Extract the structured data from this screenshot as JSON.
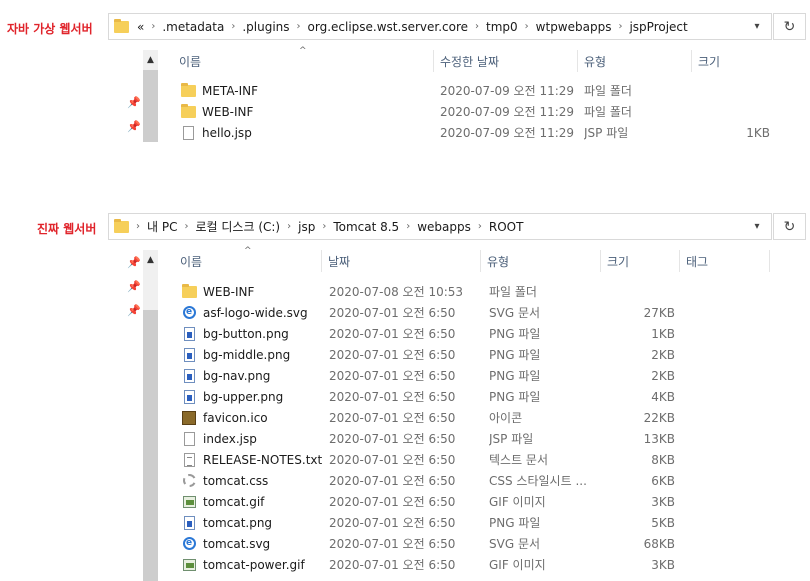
{
  "top": {
    "label": "자바 가상 웹서버",
    "crumbs": [
      "«",
      ".metadata",
      ".plugins",
      "org.eclipse.wst.server.core",
      "tmp0",
      "wtpwebapps",
      "jspProject"
    ],
    "columns": {
      "name": "이름",
      "date": "수정한 날짜",
      "type": "유형",
      "size": "크기"
    },
    "rows": [
      {
        "icon": "folder",
        "name": "META-INF",
        "date": "2020-07-09 오전 11:29",
        "type": "파일 폴더",
        "size": ""
      },
      {
        "icon": "folder",
        "name": "WEB-INF",
        "date": "2020-07-09 오전 11:29",
        "type": "파일 폴더",
        "size": ""
      },
      {
        "icon": "doc",
        "name": "hello.jsp",
        "date": "2020-07-09 오전 11:29",
        "type": "JSP 파일",
        "size": "1KB"
      }
    ]
  },
  "bottom": {
    "label": "진짜 웹서버",
    "crumbs": [
      "내 PC",
      "로컬 디스크 (C:)",
      "jsp",
      "Tomcat 8.5",
      "webapps",
      "ROOT"
    ],
    "columns": {
      "name": "이름",
      "date": "날짜",
      "type": "유형",
      "size": "크기",
      "tag": "태그"
    },
    "rows": [
      {
        "icon": "folder",
        "name": "WEB-INF",
        "date": "2020-07-08 오전 10:53",
        "type": "파일 폴더",
        "size": ""
      },
      {
        "icon": "ie",
        "name": "asf-logo-wide.svg",
        "date": "2020-07-01 오전 6:50",
        "type": "SVG 문서",
        "size": "27KB"
      },
      {
        "icon": "img",
        "name": "bg-button.png",
        "date": "2020-07-01 오전 6:50",
        "type": "PNG 파일",
        "size": "1KB"
      },
      {
        "icon": "img",
        "name": "bg-middle.png",
        "date": "2020-07-01 오전 6:50",
        "type": "PNG 파일",
        "size": "2KB"
      },
      {
        "icon": "img",
        "name": "bg-nav.png",
        "date": "2020-07-01 오전 6:50",
        "type": "PNG 파일",
        "size": "2KB"
      },
      {
        "icon": "img",
        "name": "bg-upper.png",
        "date": "2020-07-01 오전 6:50",
        "type": "PNG 파일",
        "size": "4KB"
      },
      {
        "icon": "ico",
        "name": "favicon.ico",
        "date": "2020-07-01 오전 6:50",
        "type": "아이콘",
        "size": "22KB"
      },
      {
        "icon": "doc",
        "name": "index.jsp",
        "date": "2020-07-01 오전 6:50",
        "type": "JSP 파일",
        "size": "13KB"
      },
      {
        "icon": "txt",
        "name": "RELEASE-NOTES.txt",
        "date": "2020-07-01 오전 6:50",
        "type": "텍스트 문서",
        "size": "8KB"
      },
      {
        "icon": "css",
        "name": "tomcat.css",
        "date": "2020-07-01 오전 6:50",
        "type": "CSS 스타일시트 ...",
        "size": "6KB"
      },
      {
        "icon": "gif",
        "name": "tomcat.gif",
        "date": "2020-07-01 오전 6:50",
        "type": "GIF 이미지",
        "size": "3KB"
      },
      {
        "icon": "img",
        "name": "tomcat.png",
        "date": "2020-07-01 오전 6:50",
        "type": "PNG 파일",
        "size": "5KB"
      },
      {
        "icon": "ie",
        "name": "tomcat.svg",
        "date": "2020-07-01 오전 6:50",
        "type": "SVG 문서",
        "size": "68KB"
      },
      {
        "icon": "gif",
        "name": "tomcat-power.gif",
        "date": "2020-07-01 오전 6:50",
        "type": "GIF 이미지",
        "size": "3KB"
      }
    ]
  }
}
